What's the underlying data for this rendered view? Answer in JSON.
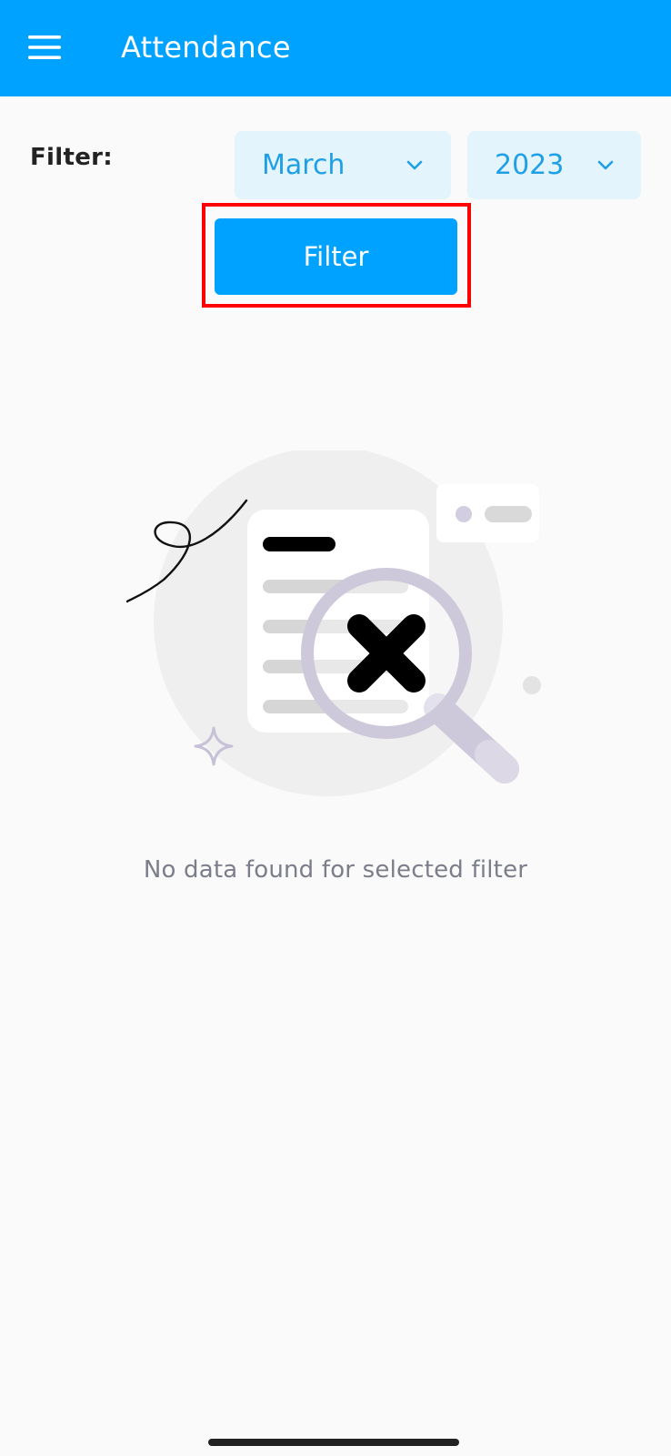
{
  "app_bar": {
    "title": "Attendance",
    "menu_icon": "hamburger-menu-icon",
    "background": "#00a2ff"
  },
  "filter": {
    "label": "Filter:",
    "month": {
      "value": "March",
      "icon": "chevron-down-icon"
    },
    "year": {
      "value": "2023",
      "icon": "chevron-down-icon"
    },
    "button_label": "Filter",
    "highlight_color": "#ff0000"
  },
  "empty_state": {
    "illustration": "no-results-magnifier-illustration",
    "message": "No data found for selected filter"
  },
  "colors": {
    "accent": "#00a2ff",
    "dropdown_bg": "#e3f4fd",
    "dropdown_text": "#1e9fe6",
    "muted_text": "#7b7e8a"
  }
}
